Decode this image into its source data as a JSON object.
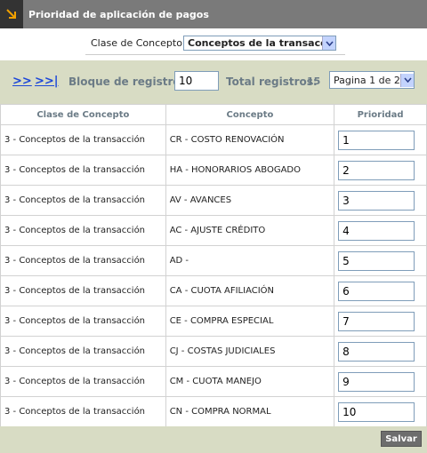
{
  "header": {
    "title": "Prioridad de aplicación de pagos"
  },
  "filter": {
    "label": "Clase de Concepto",
    "selected": "Conceptos de la transacción"
  },
  "toolbar": {
    "next_label": ">>",
    "last_label": ">>|",
    "block_label": "Bloque de registros:",
    "block_value": "10",
    "total_label": "Total registros:",
    "total_value": "15",
    "page_selected": "Pagina 1 de 2"
  },
  "table": {
    "headers": [
      "Clase de Concepto",
      "Concepto",
      "Prioridad"
    ],
    "rows": [
      {
        "clase": "3 - Conceptos de la transacción",
        "concepto": "CR - COSTO RENOVACIÓN",
        "prioridad": "1"
      },
      {
        "clase": "3 - Conceptos de la transacción",
        "concepto": "HA - HONORARIOS ABOGADO",
        "prioridad": "2"
      },
      {
        "clase": "3 - Conceptos de la transacción",
        "concepto": "AV - AVANCES",
        "prioridad": "3"
      },
      {
        "clase": "3 - Conceptos de la transacción",
        "concepto": "AC - AJUSTE CRÉDITO",
        "prioridad": "4"
      },
      {
        "clase": "3 - Conceptos de la transacción",
        "concepto": "AD -",
        "prioridad": "5"
      },
      {
        "clase": "3 - Conceptos de la transacción",
        "concepto": "CA - CUOTA AFILIACIÓN",
        "prioridad": "6"
      },
      {
        "clase": "3 - Conceptos de la transacción",
        "concepto": "CE - COMPRA ESPECIAL",
        "prioridad": "7"
      },
      {
        "clase": "3 - Conceptos de la transacción",
        "concepto": "CJ - COSTAS JUDICIALES",
        "prioridad": "8"
      },
      {
        "clase": "3 - Conceptos de la transacción",
        "concepto": "CM - CUOTA MANEJO",
        "prioridad": "9"
      },
      {
        "clase": "3 - Conceptos de la transacción",
        "concepto": "CN - COMPRA NORMAL",
        "prioridad": "10"
      }
    ]
  },
  "footer": {
    "save_label": "Salvar"
  },
  "icons": {
    "title_icon": "arrow-down-right-icon",
    "dropdown_icon": "chevron-down-icon"
  },
  "colors": {
    "title_bg": "#7a7a7a",
    "toolbar_bg": "#d8dcc4",
    "link": "#1c47d8",
    "accent_icon": "#f0a000"
  }
}
